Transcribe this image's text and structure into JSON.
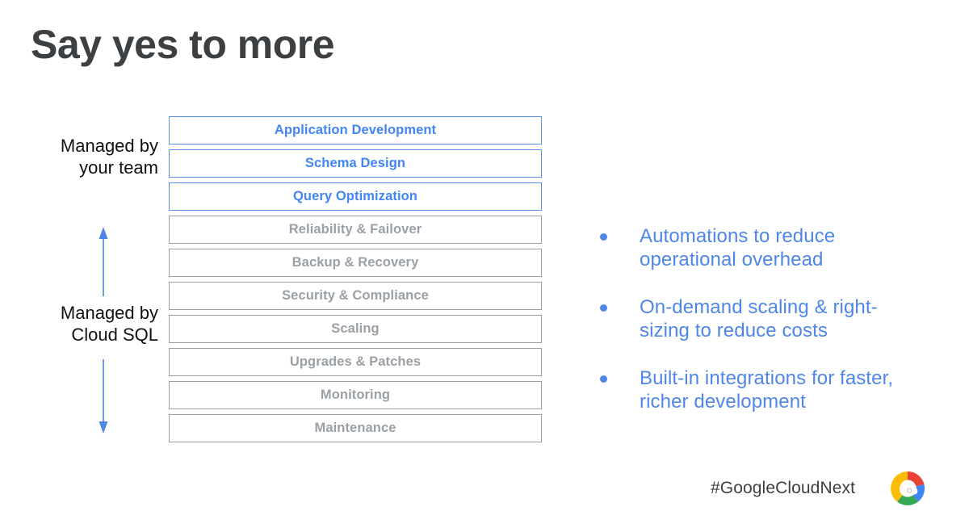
{
  "slide": {
    "title": "Say yes to more"
  },
  "diagram": {
    "side_labels": {
      "top": "Managed by\nyour team",
      "bottom": "Managed by\nCloud SQL"
    },
    "arrows": {
      "up": "arrow-up-icon",
      "down": "arrow-down-icon"
    },
    "colors": {
      "managed_by_team": "#4285f4",
      "managed_by_cloudsql": "#9aa0a6",
      "arrow": "#4f86e8"
    },
    "layers": [
      {
        "label": "Application Development",
        "owner": "your team"
      },
      {
        "label": "Schema Design",
        "owner": "your team"
      },
      {
        "label": "Query Optimization",
        "owner": "your team"
      },
      {
        "label": "Reliability & Failover",
        "owner": "Cloud SQL"
      },
      {
        "label": "Backup & Recovery",
        "owner": "Cloud SQL"
      },
      {
        "label": "Security & Compliance",
        "owner": "Cloud SQL"
      },
      {
        "label": "Scaling",
        "owner": "Cloud SQL"
      },
      {
        "label": "Upgrades & Patches",
        "owner": "Cloud SQL"
      },
      {
        "label": "Monitoring",
        "owner": "Cloud SQL"
      },
      {
        "label": "Maintenance",
        "owner": "Cloud SQL"
      }
    ]
  },
  "benefits": {
    "bullet_color": "#4f86e8",
    "items": [
      {
        "text": "Automations to reduce operational overhead"
      },
      {
        "text": "On-demand scaling & right-sizing to reduce costs"
      },
      {
        "text": "Built-in integrations for faster, richer development"
      }
    ]
  },
  "footer": {
    "hashtag": "#GoogleCloudNext",
    "logo": "google-cloud-logo"
  }
}
